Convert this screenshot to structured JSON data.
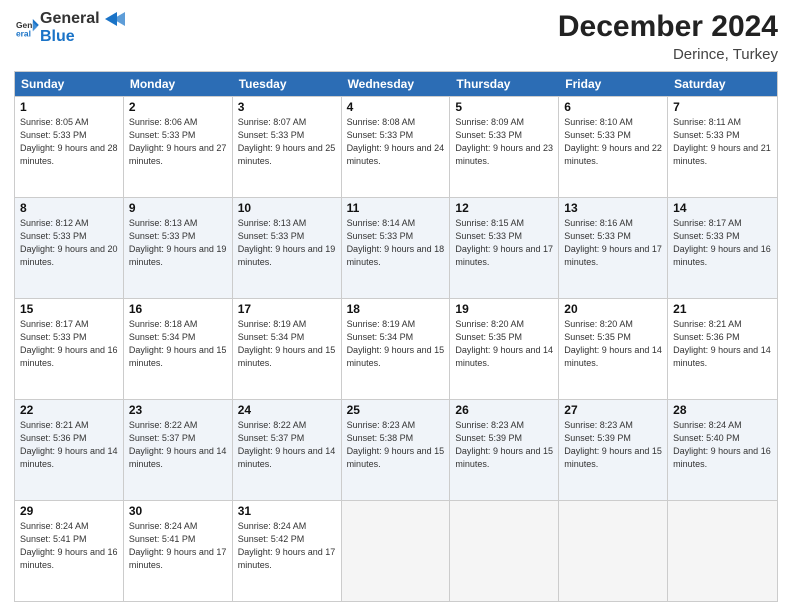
{
  "logo": {
    "line1": "General",
    "line2": "Blue"
  },
  "title": "December 2024",
  "subtitle": "Derince, Turkey",
  "header_days": [
    "Sunday",
    "Monday",
    "Tuesday",
    "Wednesday",
    "Thursday",
    "Friday",
    "Saturday"
  ],
  "rows": [
    [
      {
        "day": "1",
        "sunrise": "Sunrise: 8:05 AM",
        "sunset": "Sunset: 5:33 PM",
        "daylight": "Daylight: 9 hours and 28 minutes."
      },
      {
        "day": "2",
        "sunrise": "Sunrise: 8:06 AM",
        "sunset": "Sunset: 5:33 PM",
        "daylight": "Daylight: 9 hours and 27 minutes."
      },
      {
        "day": "3",
        "sunrise": "Sunrise: 8:07 AM",
        "sunset": "Sunset: 5:33 PM",
        "daylight": "Daylight: 9 hours and 25 minutes."
      },
      {
        "day": "4",
        "sunrise": "Sunrise: 8:08 AM",
        "sunset": "Sunset: 5:33 PM",
        "daylight": "Daylight: 9 hours and 24 minutes."
      },
      {
        "day": "5",
        "sunrise": "Sunrise: 8:09 AM",
        "sunset": "Sunset: 5:33 PM",
        "daylight": "Daylight: 9 hours and 23 minutes."
      },
      {
        "day": "6",
        "sunrise": "Sunrise: 8:10 AM",
        "sunset": "Sunset: 5:33 PM",
        "daylight": "Daylight: 9 hours and 22 minutes."
      },
      {
        "day": "7",
        "sunrise": "Sunrise: 8:11 AM",
        "sunset": "Sunset: 5:33 PM",
        "daylight": "Daylight: 9 hours and 21 minutes."
      }
    ],
    [
      {
        "day": "8",
        "sunrise": "Sunrise: 8:12 AM",
        "sunset": "Sunset: 5:33 PM",
        "daylight": "Daylight: 9 hours and 20 minutes."
      },
      {
        "day": "9",
        "sunrise": "Sunrise: 8:13 AM",
        "sunset": "Sunset: 5:33 PM",
        "daylight": "Daylight: 9 hours and 19 minutes."
      },
      {
        "day": "10",
        "sunrise": "Sunrise: 8:13 AM",
        "sunset": "Sunset: 5:33 PM",
        "daylight": "Daylight: 9 hours and 19 minutes."
      },
      {
        "day": "11",
        "sunrise": "Sunrise: 8:14 AM",
        "sunset": "Sunset: 5:33 PM",
        "daylight": "Daylight: 9 hours and 18 minutes."
      },
      {
        "day": "12",
        "sunrise": "Sunrise: 8:15 AM",
        "sunset": "Sunset: 5:33 PM",
        "daylight": "Daylight: 9 hours and 17 minutes."
      },
      {
        "day": "13",
        "sunrise": "Sunrise: 8:16 AM",
        "sunset": "Sunset: 5:33 PM",
        "daylight": "Daylight: 9 hours and 17 minutes."
      },
      {
        "day": "14",
        "sunrise": "Sunrise: 8:17 AM",
        "sunset": "Sunset: 5:33 PM",
        "daylight": "Daylight: 9 hours and 16 minutes."
      }
    ],
    [
      {
        "day": "15",
        "sunrise": "Sunrise: 8:17 AM",
        "sunset": "Sunset: 5:33 PM",
        "daylight": "Daylight: 9 hours and 16 minutes."
      },
      {
        "day": "16",
        "sunrise": "Sunrise: 8:18 AM",
        "sunset": "Sunset: 5:34 PM",
        "daylight": "Daylight: 9 hours and 15 minutes."
      },
      {
        "day": "17",
        "sunrise": "Sunrise: 8:19 AM",
        "sunset": "Sunset: 5:34 PM",
        "daylight": "Daylight: 9 hours and 15 minutes."
      },
      {
        "day": "18",
        "sunrise": "Sunrise: 8:19 AM",
        "sunset": "Sunset: 5:34 PM",
        "daylight": "Daylight: 9 hours and 15 minutes."
      },
      {
        "day": "19",
        "sunrise": "Sunrise: 8:20 AM",
        "sunset": "Sunset: 5:35 PM",
        "daylight": "Daylight: 9 hours and 14 minutes."
      },
      {
        "day": "20",
        "sunrise": "Sunrise: 8:20 AM",
        "sunset": "Sunset: 5:35 PM",
        "daylight": "Daylight: 9 hours and 14 minutes."
      },
      {
        "day": "21",
        "sunrise": "Sunrise: 8:21 AM",
        "sunset": "Sunset: 5:36 PM",
        "daylight": "Daylight: 9 hours and 14 minutes."
      }
    ],
    [
      {
        "day": "22",
        "sunrise": "Sunrise: 8:21 AM",
        "sunset": "Sunset: 5:36 PM",
        "daylight": "Daylight: 9 hours and 14 minutes."
      },
      {
        "day": "23",
        "sunrise": "Sunrise: 8:22 AM",
        "sunset": "Sunset: 5:37 PM",
        "daylight": "Daylight: 9 hours and 14 minutes."
      },
      {
        "day": "24",
        "sunrise": "Sunrise: 8:22 AM",
        "sunset": "Sunset: 5:37 PM",
        "daylight": "Daylight: 9 hours and 14 minutes."
      },
      {
        "day": "25",
        "sunrise": "Sunrise: 8:23 AM",
        "sunset": "Sunset: 5:38 PM",
        "daylight": "Daylight: 9 hours and 15 minutes."
      },
      {
        "day": "26",
        "sunrise": "Sunrise: 8:23 AM",
        "sunset": "Sunset: 5:39 PM",
        "daylight": "Daylight: 9 hours and 15 minutes."
      },
      {
        "day": "27",
        "sunrise": "Sunrise: 8:23 AM",
        "sunset": "Sunset: 5:39 PM",
        "daylight": "Daylight: 9 hours and 15 minutes."
      },
      {
        "day": "28",
        "sunrise": "Sunrise: 8:24 AM",
        "sunset": "Sunset: 5:40 PM",
        "daylight": "Daylight: 9 hours and 16 minutes."
      }
    ],
    [
      {
        "day": "29",
        "sunrise": "Sunrise: 8:24 AM",
        "sunset": "Sunset: 5:41 PM",
        "daylight": "Daylight: 9 hours and 16 minutes."
      },
      {
        "day": "30",
        "sunrise": "Sunrise: 8:24 AM",
        "sunset": "Sunset: 5:41 PM",
        "daylight": "Daylight: 9 hours and 17 minutes."
      },
      {
        "day": "31",
        "sunrise": "Sunrise: 8:24 AM",
        "sunset": "Sunset: 5:42 PM",
        "daylight": "Daylight: 9 hours and 17 minutes."
      },
      null,
      null,
      null,
      null
    ]
  ]
}
